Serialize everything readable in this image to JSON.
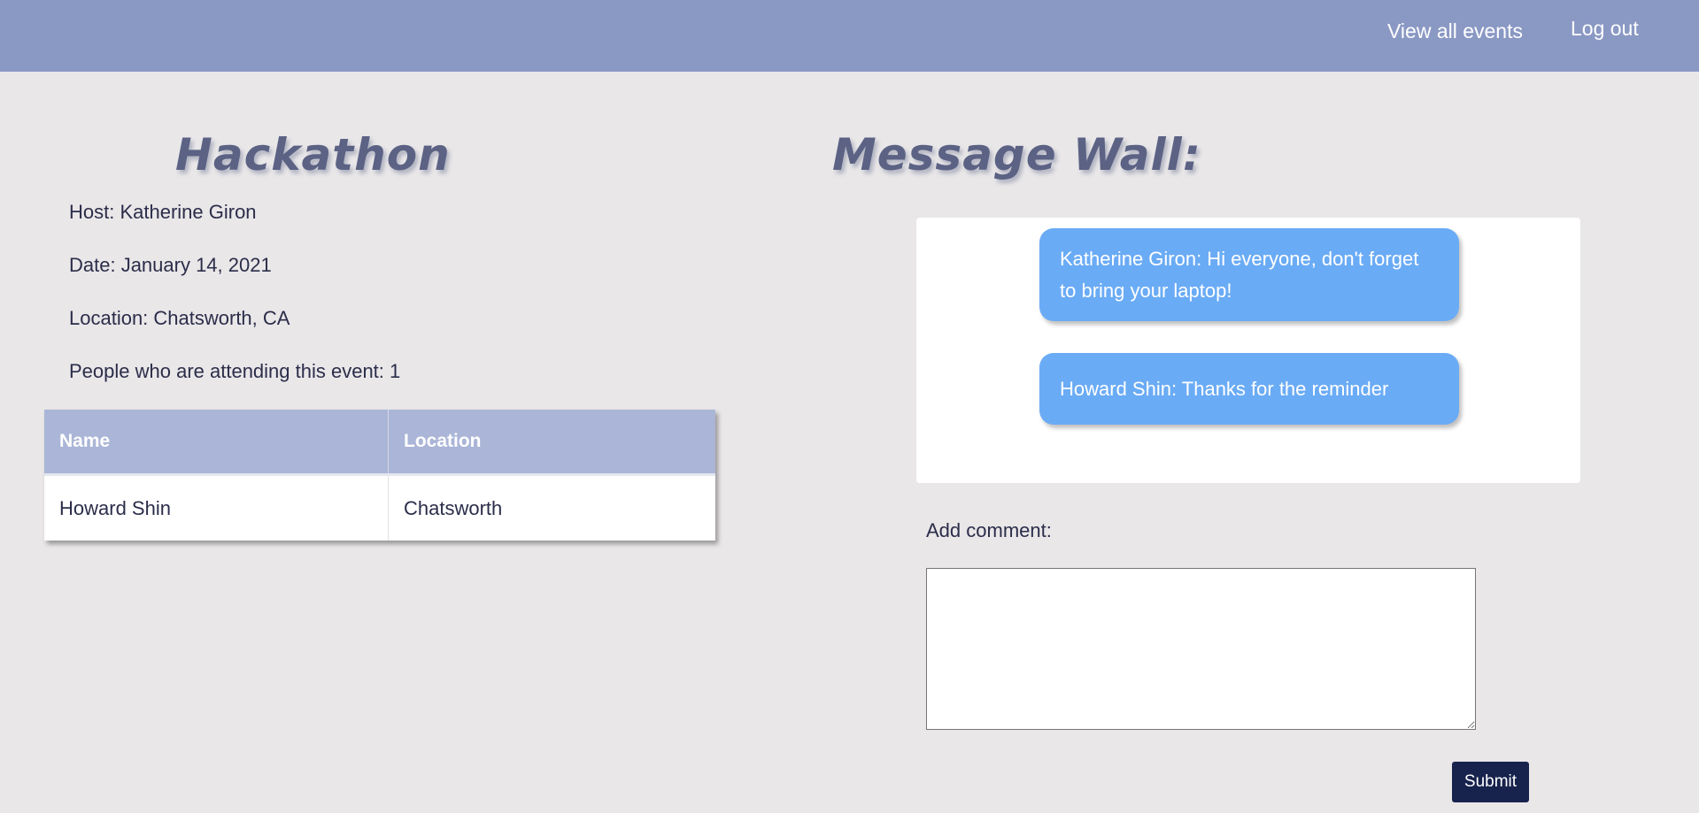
{
  "nav": {
    "view_all_events": "View all events",
    "log_out": "Log out"
  },
  "event": {
    "title": "Hackathon",
    "host": "Host: Katherine Giron",
    "date": "Date: January 14, 2021",
    "location": "Location: Chatsworth, CA",
    "attending": "People who are attending this event: 1"
  },
  "attendees": {
    "headers": [
      "Name",
      "Location"
    ],
    "rows": [
      [
        "Howard Shin",
        "Chatsworth"
      ]
    ]
  },
  "wall": {
    "title": "Message Wall:",
    "messages": [
      "Katherine Giron: Hi everyone, don't forget to bring your laptop!",
      "Howard Shin: Thanks for the reminder"
    ],
    "add_comment_label": "Add comment:",
    "comment_value": "",
    "submit_label": "Submit"
  },
  "colors": {
    "topbar": "#8a98c4",
    "page_background": "#e9e7e8",
    "table_header": "#aab5d7",
    "message_bubble": "#6aabf5",
    "submit_button": "#17224d",
    "title_text": "#5b6284"
  }
}
